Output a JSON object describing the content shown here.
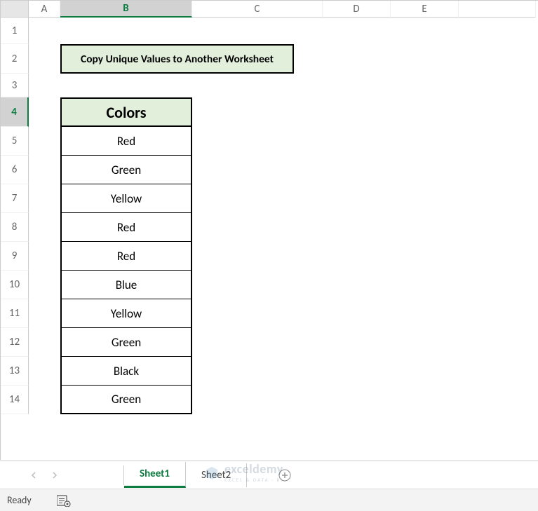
{
  "columns": [
    "A",
    "B",
    "C",
    "D",
    "E"
  ],
  "rows": [
    "1",
    "2",
    "3",
    "4",
    "5",
    "6",
    "7",
    "8",
    "9",
    "10",
    "11",
    "12",
    "13",
    "14"
  ],
  "active_row": "4",
  "active_col": "B",
  "title": "Copy Unique Values to Another Worksheet",
  "table_header": "Colors",
  "data": [
    "Red",
    "Green",
    "Yellow",
    "Red",
    "Red",
    "Blue",
    "Yellow",
    "Green",
    "Black",
    "Green"
  ],
  "sheets": {
    "tabs": [
      "Sheet1",
      "Sheet2"
    ],
    "active": "Sheet1"
  },
  "status": "Ready",
  "watermark": {
    "text": "exceldemy",
    "sub": "EXCEL & DATA · BI"
  }
}
